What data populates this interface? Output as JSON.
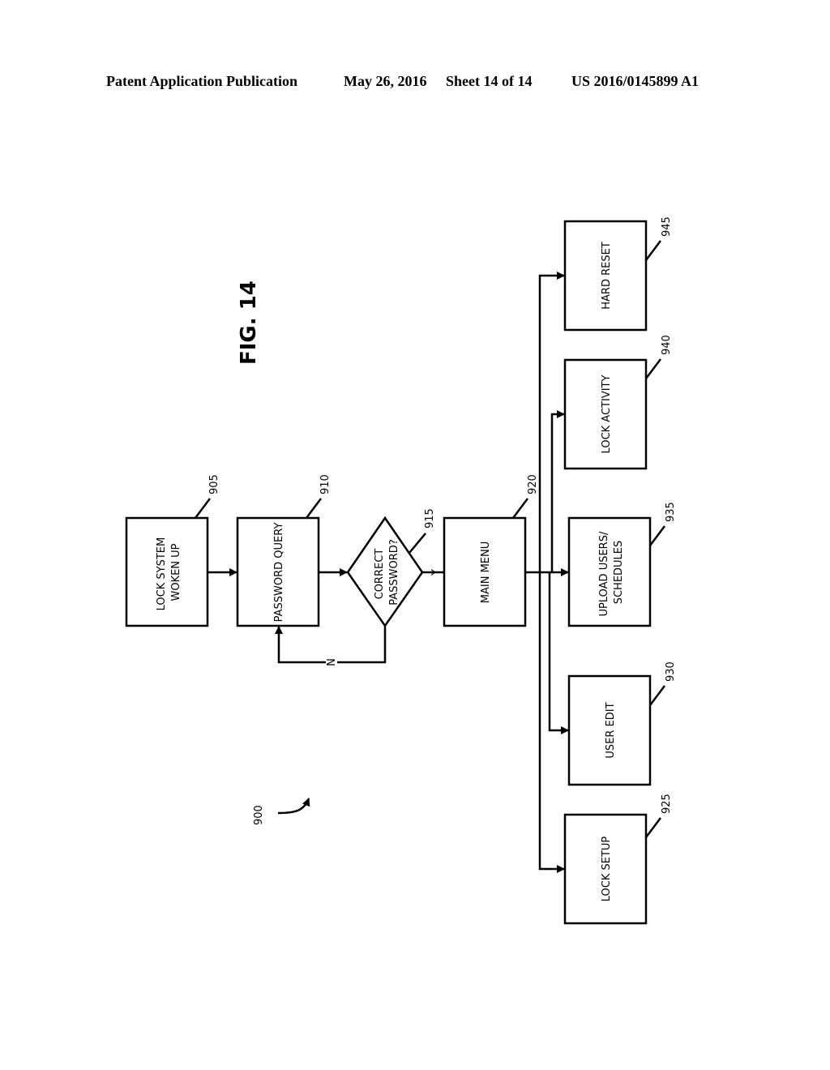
{
  "header": {
    "publication": "Patent Application Publication",
    "date": "May 26, 2016",
    "sheet": "Sheet 14 of 14",
    "number": "US 2016/0145899 A1"
  },
  "figure": {
    "title": "FIG. 14",
    "reference": "900"
  },
  "nodes": {
    "n905": {
      "ref": "905",
      "lines": [
        "LOCK SYSTEM",
        "WOKEN UP"
      ]
    },
    "n910": {
      "ref": "910",
      "lines": [
        "PASSWORD QUERY"
      ]
    },
    "n915": {
      "ref": "915",
      "lines": [
        "CORRECT",
        "PASSWORD?"
      ]
    },
    "n920": {
      "ref": "920",
      "lines": [
        "MAIN MENU"
      ]
    },
    "n925": {
      "ref": "925",
      "lines": [
        "LOCK SETUP"
      ]
    },
    "n930": {
      "ref": "930",
      "lines": [
        "USER EDIT"
      ]
    },
    "n935": {
      "ref": "935",
      "lines": [
        "UPLOAD USERS/",
        "SCHEDULES"
      ]
    },
    "n940": {
      "ref": "940",
      "lines": [
        "LOCK ACTIVITY"
      ]
    },
    "n945": {
      "ref": "945",
      "lines": [
        "HARD RESET"
      ]
    }
  },
  "edges": {
    "yes_label": "Y",
    "no_label": "N"
  }
}
